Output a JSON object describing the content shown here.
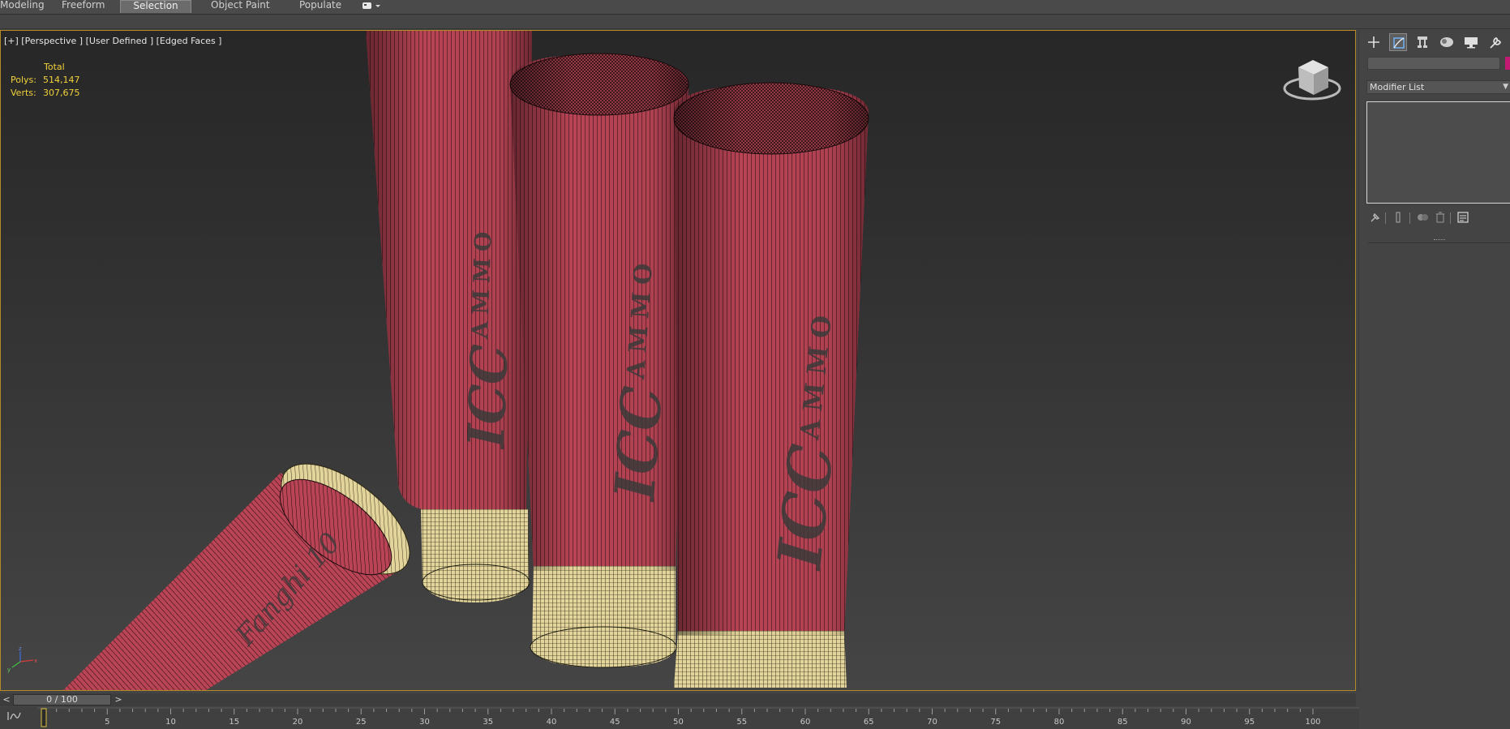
{
  "ribbon": {
    "tabs": [
      {
        "label": "Modeling",
        "active": false
      },
      {
        "label": "Freeform",
        "active": false
      },
      {
        "label": "Selection",
        "active": true
      },
      {
        "label": "Object Paint",
        "active": false
      },
      {
        "label": "Populate",
        "active": false
      }
    ],
    "options_icon": "ribbon-options-icon"
  },
  "viewport": {
    "label": "[+] [Perspective ] [User Defined ] [Edged Faces ]",
    "stats": {
      "header": "Total",
      "polys_label": "Polys:",
      "polys_value": "514,147",
      "verts_label": "Verts:",
      "verts_value": "307,675"
    },
    "scene_text": {
      "brand_a": "ICC",
      "brand_b": "AMMO",
      "brand_c": "Fanghi 10"
    },
    "viewcube_icon": "viewcube-icon",
    "axis_icon": "axis-tripod-icon"
  },
  "command_panel": {
    "tabs": [
      {
        "icon": "create-icon"
      },
      {
        "icon": "modify-icon",
        "active": true
      },
      {
        "icon": "hierarchy-icon"
      },
      {
        "icon": "motion-icon"
      },
      {
        "icon": "display-icon"
      },
      {
        "icon": "utilities-icon"
      }
    ],
    "modifier_list": "Modifier List",
    "object_color": "#c21a73",
    "stack_buttons": [
      "pin-stack-icon",
      "show-end-result-icon",
      "make-unique-icon",
      "remove-modifier-icon",
      "configure-sets-icon"
    ]
  },
  "timeline": {
    "frame_display": "0 / 100",
    "prev_label": "<",
    "next_label": ">",
    "ticks": [
      "5",
      "10",
      "15",
      "20",
      "25",
      "30",
      "35",
      "40",
      "45",
      "50",
      "55",
      "60",
      "65",
      "70",
      "75",
      "80",
      "85",
      "90",
      "95",
      "100"
    ],
    "curve_editor_icon": "mini-curve-editor-icon"
  }
}
